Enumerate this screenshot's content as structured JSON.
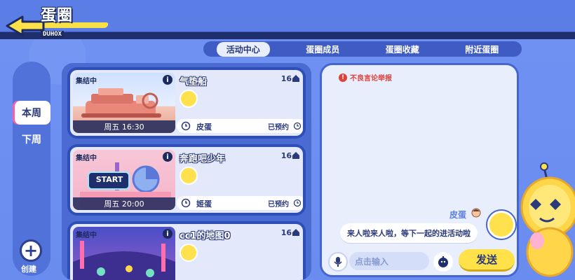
{
  "header": {
    "title": "蛋圈",
    "subtitle": "DUHOX"
  },
  "tabs": [
    {
      "label": "活动中心",
      "active": true
    },
    {
      "label": "蛋圈成员",
      "active": false
    },
    {
      "label": "蛋圈收藏",
      "active": false
    },
    {
      "label": "附近蛋圈",
      "active": false
    }
  ],
  "weeks": [
    {
      "label": "本周",
      "active": true
    },
    {
      "label": "下周",
      "active": false
    }
  ],
  "create_label": "创建",
  "activities": [
    {
      "tag": "集结中",
      "time": "周五 16:30",
      "title": "气垫船",
      "level": "16",
      "host": "皮蛋",
      "status": "已预约",
      "thumb_theme": "ship"
    },
    {
      "tag": "集结中",
      "time": "周五 20:00",
      "title": "奔跑吧少年",
      "level": "16",
      "host": "姬蛋",
      "status": "已预约",
      "thumb_theme": "start",
      "thumb_text": "START"
    },
    {
      "tag": "集结中",
      "time": "",
      "title": "cc1的地图0",
      "level": "16",
      "host": "",
      "status": "",
      "thumb_theme": "map"
    }
  ],
  "chat": {
    "report_label": "不良言论举报",
    "messages": [
      {
        "sender": "皮蛋",
        "text": "来人啦来人啦，等下一起的进活动啦"
      }
    ],
    "input_placeholder": "点击输入",
    "send_label": "发送"
  },
  "colors": {
    "accent_yellow": "#ffe24a",
    "primary_blue": "#5a7de6",
    "dark_navy": "#2b3a7a",
    "report_red": "#e0403a"
  }
}
